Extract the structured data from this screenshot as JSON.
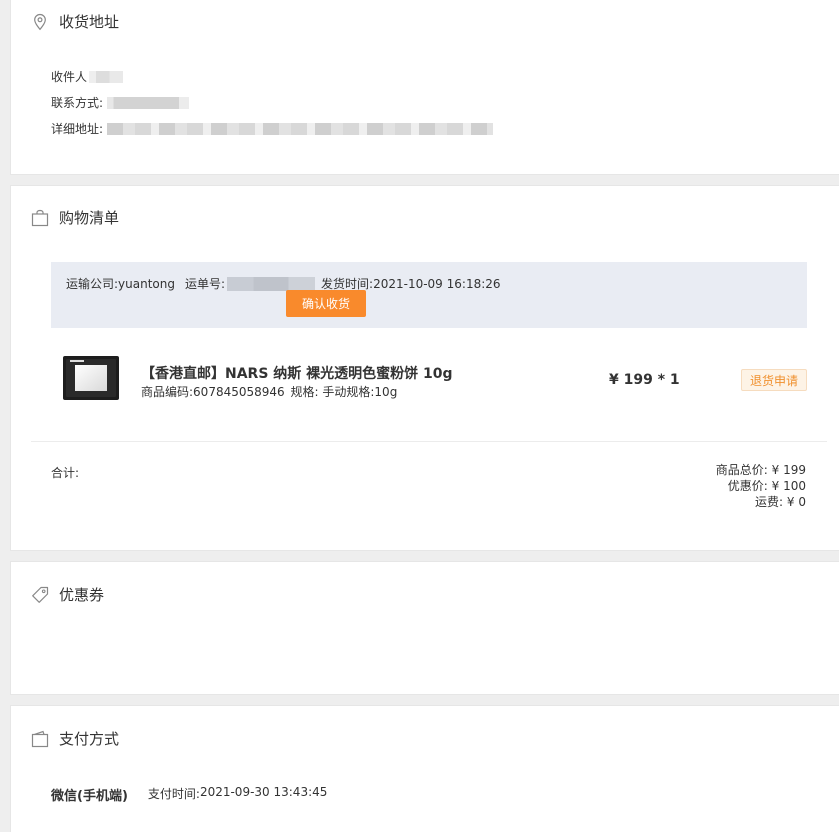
{
  "address": {
    "title": "收货地址",
    "icon": "location-pin-icon",
    "recipient_label": "收件人",
    "contact_label": "联系方式:",
    "detail_label": "详细地址:"
  },
  "shopping": {
    "title": "购物清单",
    "icon": "shopping-bag-icon",
    "shipping": {
      "company_label": "运输公司:",
      "company": "yuantong",
      "tracking_label": "运单号:",
      "ship_time_label": "发货时间:",
      "ship_time": "2021-10-09 16:18:26",
      "confirm_button": "确认收货"
    },
    "product": {
      "name": "【香港直邮】NARS 纳斯 裸光透明色蜜粉饼 10g",
      "code_label": "商品编码:",
      "code": "607845058946",
      "spec_label": "规格:",
      "spec": "手动规格:10g",
      "price": "¥ 199 * 1",
      "return_button": "退货申请"
    },
    "total_label": "合计:",
    "summary": {
      "goods_total": "商品总价: ¥ 199",
      "discount": "优惠价: ¥ 100",
      "shipping_fee": "运费: ¥ 0"
    }
  },
  "coupon": {
    "title": "优惠券",
    "icon": "tag-icon"
  },
  "payment": {
    "title": "支付方式",
    "icon": "wallet-icon",
    "method": "微信(手机端)",
    "time_label": "支付时间:",
    "time": "2021-09-30 13:43:45"
  },
  "colors": {
    "accent": "#f98a2c",
    "ship_box_bg": "#e9ecf3",
    "return_btn_text": "#f0902e"
  }
}
